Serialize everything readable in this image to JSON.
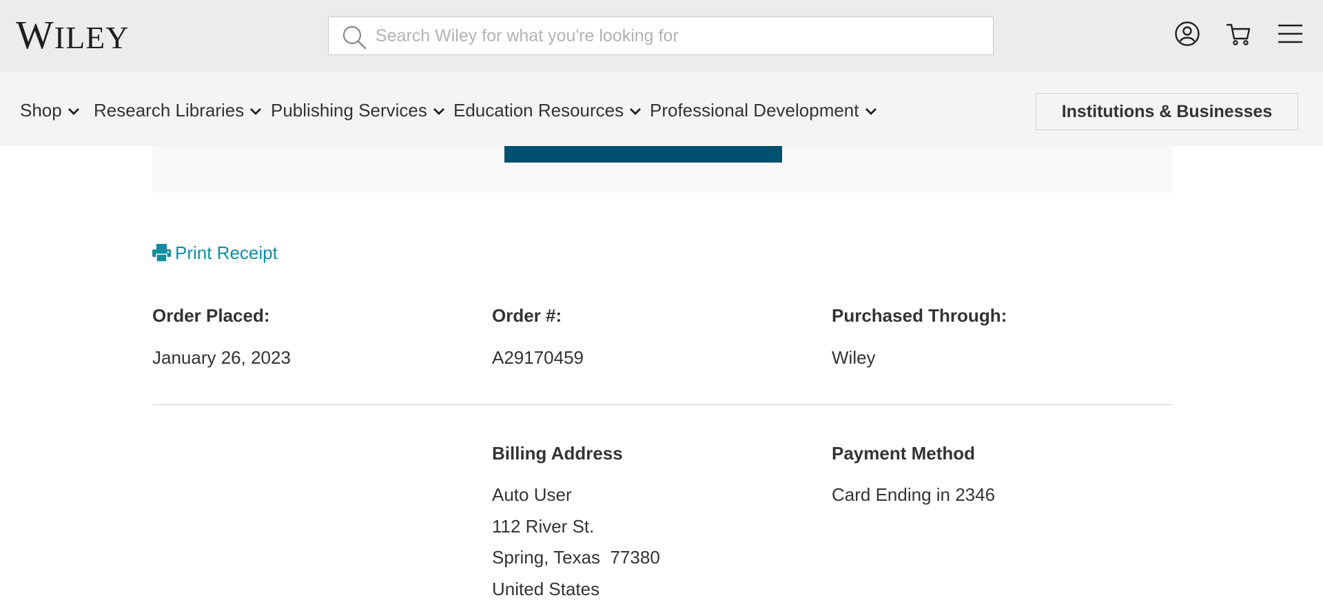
{
  "header": {
    "logo_cap": "W",
    "logo_rest": "ILEY",
    "search_placeholder": "Search Wiley for what you're looking for",
    "icons": [
      "search-icon",
      "account-icon",
      "cart-icon",
      "menu-icon"
    ]
  },
  "nav": {
    "items": [
      {
        "label": "Shop"
      },
      {
        "label": "Research Libraries"
      },
      {
        "label": "Publishing Services"
      },
      {
        "label": "Education Resources"
      },
      {
        "label": "Professional Development"
      }
    ],
    "institutions_button": "Institutions & Businesses"
  },
  "order": {
    "print_receipt": "Print Receipt",
    "order_placed_label": "Order Placed:",
    "order_placed_value": "January 26, 2023",
    "order_number_label": "Order #:",
    "order_number_value": "A29170459",
    "purchased_through_label": "Purchased Through:",
    "purchased_through_value": "Wiley",
    "billing_address_label": "Billing Address",
    "billing_address_lines": [
      "Auto User",
      "112 River St.",
      "Spring, Texas  77380",
      "United States"
    ],
    "payment_method_label": "Payment Method",
    "payment_method_value": "Card Ending in 2346"
  },
  "colors": {
    "header_bg": "#ececec",
    "nav_bg": "#f4f4f4",
    "primary_button": "#00506f",
    "link": "#0e8fa0",
    "text": "#333333"
  }
}
